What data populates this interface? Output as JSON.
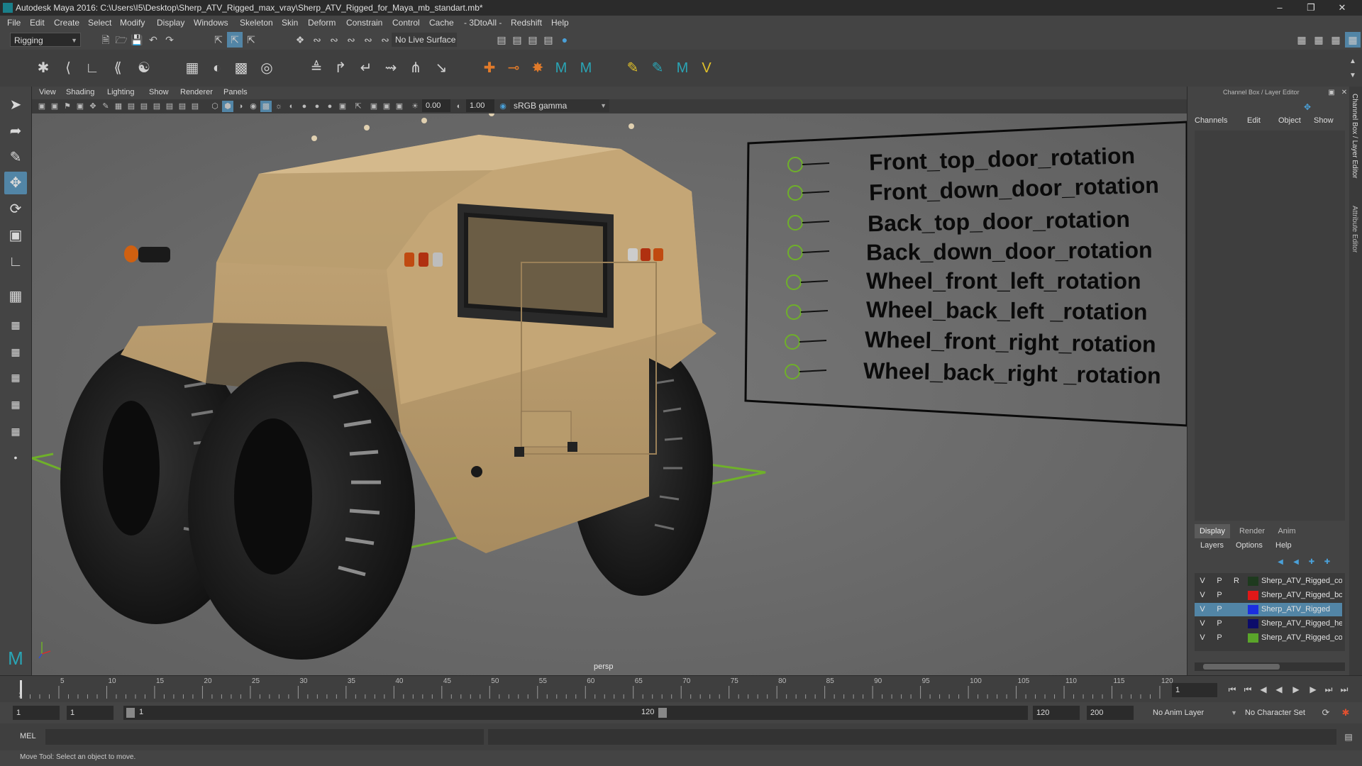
{
  "title_bar": {
    "text": "Autodesk Maya 2016: C:\\Users\\I5\\Desktop\\Sherp_ATV_Rigged_max_vray\\Sherp_ATV_Rigged_for_Maya_mb_standart.mb*"
  },
  "menu": [
    "File",
    "Edit",
    "Create",
    "Select",
    "Modify",
    "Display",
    "Windows",
    "Skeleton",
    "Skin",
    "Deform",
    "Constrain",
    "Control",
    "Cache",
    "- 3DtoAll -",
    "Redshift",
    "Help"
  ],
  "status_line": {
    "menu_set": "Rigging",
    "live_surface": "No Live Surface"
  },
  "viewport": {
    "menu": [
      "View",
      "Shading",
      "Lighting",
      "Show",
      "Renderer",
      "Panels"
    ],
    "near_clip": "0.00",
    "far_clip": "1.00",
    "color_space": "sRGB gamma",
    "camera_label": "persp",
    "controls": [
      "Front_top_door_rotation",
      "Front_down_door_rotation",
      "Back_top_door_rotation",
      "Back_down_door_rotation",
      "Wheel_front_left_rotation",
      "Wheel_back_left _rotation",
      "Wheel_front_right_rotation",
      "Wheel_back_right _rotation"
    ]
  },
  "channel_box": {
    "title": "Channel Box / Layer Editor",
    "menu": [
      "Channels",
      "Edit",
      "Object",
      "Show"
    ],
    "side_tabs": [
      "Channel Box / Layer Editor",
      "Attribute Editor"
    ]
  },
  "layer_editor": {
    "tabs": [
      "Display",
      "Render",
      "Anim"
    ],
    "menu": [
      "Layers",
      "Options",
      "Help"
    ],
    "layers": [
      {
        "v": "V",
        "p": "P",
        "r": "R",
        "color": "#1e3a1e",
        "name": "Sherp_ATV_Rigged_co",
        "selected": false
      },
      {
        "v": "V",
        "p": "P",
        "r": "",
        "color": "#e01818",
        "name": "Sherp_ATV_Rigged_bc",
        "selected": false
      },
      {
        "v": "V",
        "p": "P",
        "r": "",
        "color": "#1b2ee0",
        "name": "Sherp_ATV_Rigged",
        "selected": true
      },
      {
        "v": "V",
        "p": "P",
        "r": "",
        "color": "#0c0c6a",
        "name": "Sherp_ATV_Rigged_he",
        "selected": false
      },
      {
        "v": "V",
        "p": "P",
        "r": "",
        "color": "#5aa52a",
        "name": "Sherp_ATV_Rigged_co",
        "selected": false
      }
    ]
  },
  "timeline": {
    "ticks": [
      "5",
      "10",
      "15",
      "20",
      "25",
      "30",
      "35",
      "40",
      "45",
      "50",
      "55",
      "60",
      "65",
      "70",
      "75",
      "80",
      "85",
      "90",
      "95",
      "100",
      "105",
      "110",
      "115",
      "120"
    ],
    "start_label": "1",
    "current_frame": "1"
  },
  "range": {
    "start": "1",
    "playback_start": "1",
    "slider_start": "1",
    "slider_end": "120",
    "playback_end": "120",
    "end": "200",
    "anim_layer": "No Anim Layer",
    "character_set": "No Character Set"
  },
  "command_line": {
    "label": "MEL"
  },
  "help_line": {
    "text": "Move Tool: Select an object to move."
  }
}
